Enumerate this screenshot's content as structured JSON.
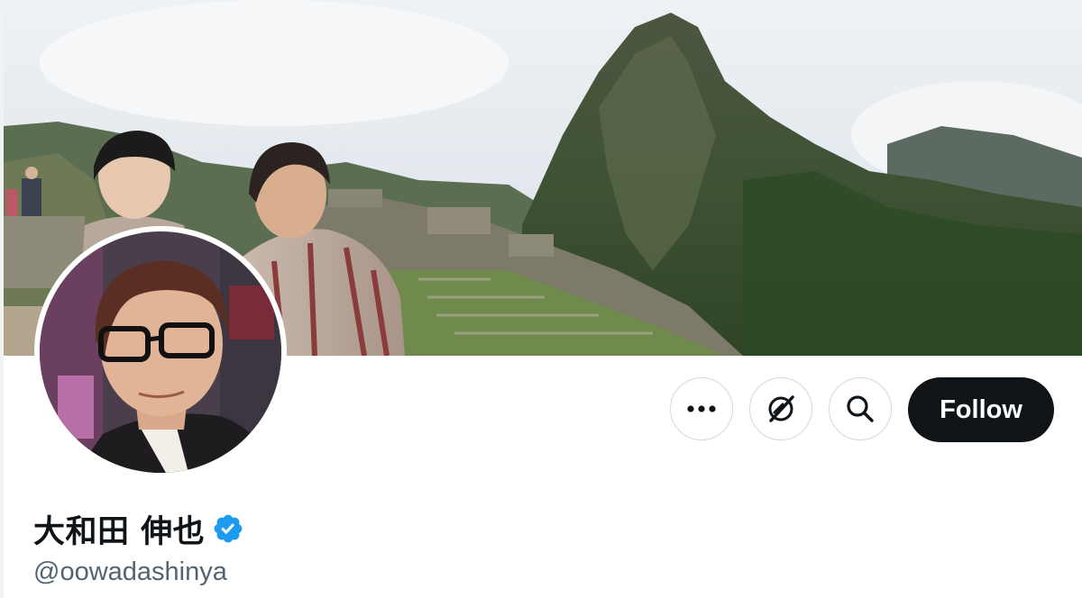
{
  "profile": {
    "display_name": "大和田 伸也",
    "handle": "@oowadashinya",
    "verified": true,
    "verified_icon": "verified-badge-icon"
  },
  "actions": {
    "more_icon": "more-horizontal-icon",
    "grok_icon": "grok-icon",
    "search_icon": "search-icon",
    "follow_label": "Follow"
  },
  "colors": {
    "follow_bg": "#0f1419",
    "follow_text": "#ffffff",
    "verified_blue": "#1d9bf0",
    "handle_gray": "#536471",
    "button_border": "#cfd9de"
  }
}
